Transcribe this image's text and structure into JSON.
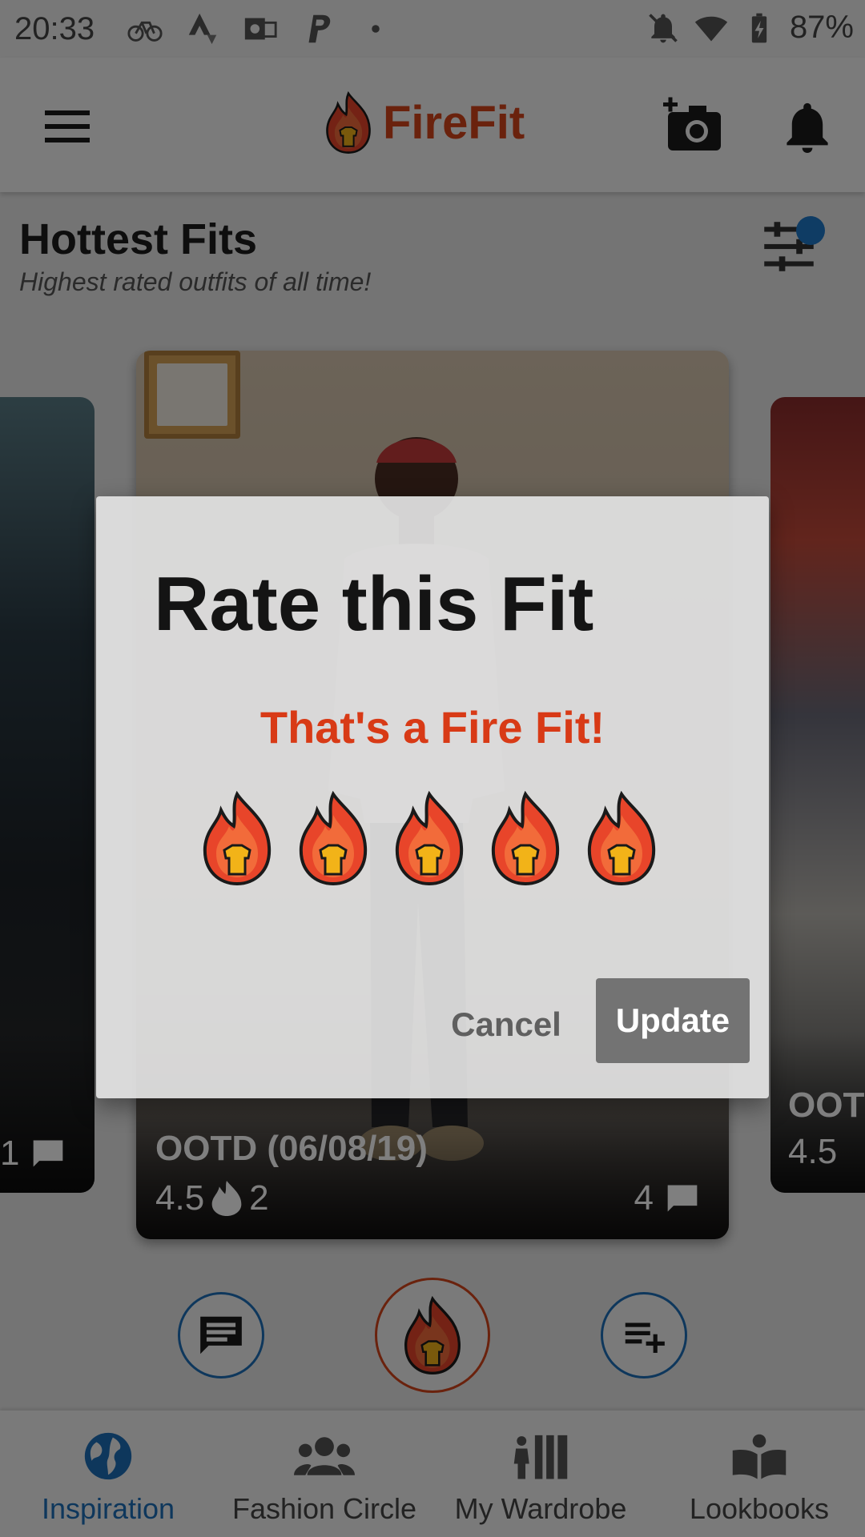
{
  "status_bar": {
    "time": "20:33",
    "battery": "87%",
    "left_icons": [
      "bike-icon",
      "strava-icon",
      "outlook-icon",
      "paypal-icon",
      "dot-icon"
    ],
    "right_icons": [
      "notifications-off-icon",
      "wifi-icon",
      "battery-icon"
    ]
  },
  "app_bar": {
    "title": "FireFit",
    "brand_color": "#d4441b",
    "icons": [
      "menu-icon",
      "add-photo-icon",
      "bell-icon"
    ]
  },
  "section": {
    "title": "Hottest Fits",
    "subtitle": "Highest rated outfits of all time!"
  },
  "cards": {
    "left": {
      "comments": "1"
    },
    "center": {
      "title": "OOTD (06/08/19)",
      "rating": "4.5",
      "fires": "2",
      "comments": "4"
    },
    "right": {
      "title": "OOT",
      "rating": "4.5"
    }
  },
  "bottom_nav": {
    "active_color": "#1d6fb8",
    "items": [
      {
        "label": "Inspiration",
        "icon": "globe-icon"
      },
      {
        "label": "Fashion Circle",
        "icon": "people-icon"
      },
      {
        "label": "My Wardrobe",
        "icon": "wardrobe-icon"
      },
      {
        "label": "Lookbooks",
        "icon": "book-icon"
      }
    ]
  },
  "dialog": {
    "title": "Rate this Fit",
    "message": "That's a Fire Fit!",
    "rating": 5,
    "rating_max": 5,
    "cancel_label": "Cancel",
    "update_label": "Update",
    "message_color": "#d83a16"
  }
}
